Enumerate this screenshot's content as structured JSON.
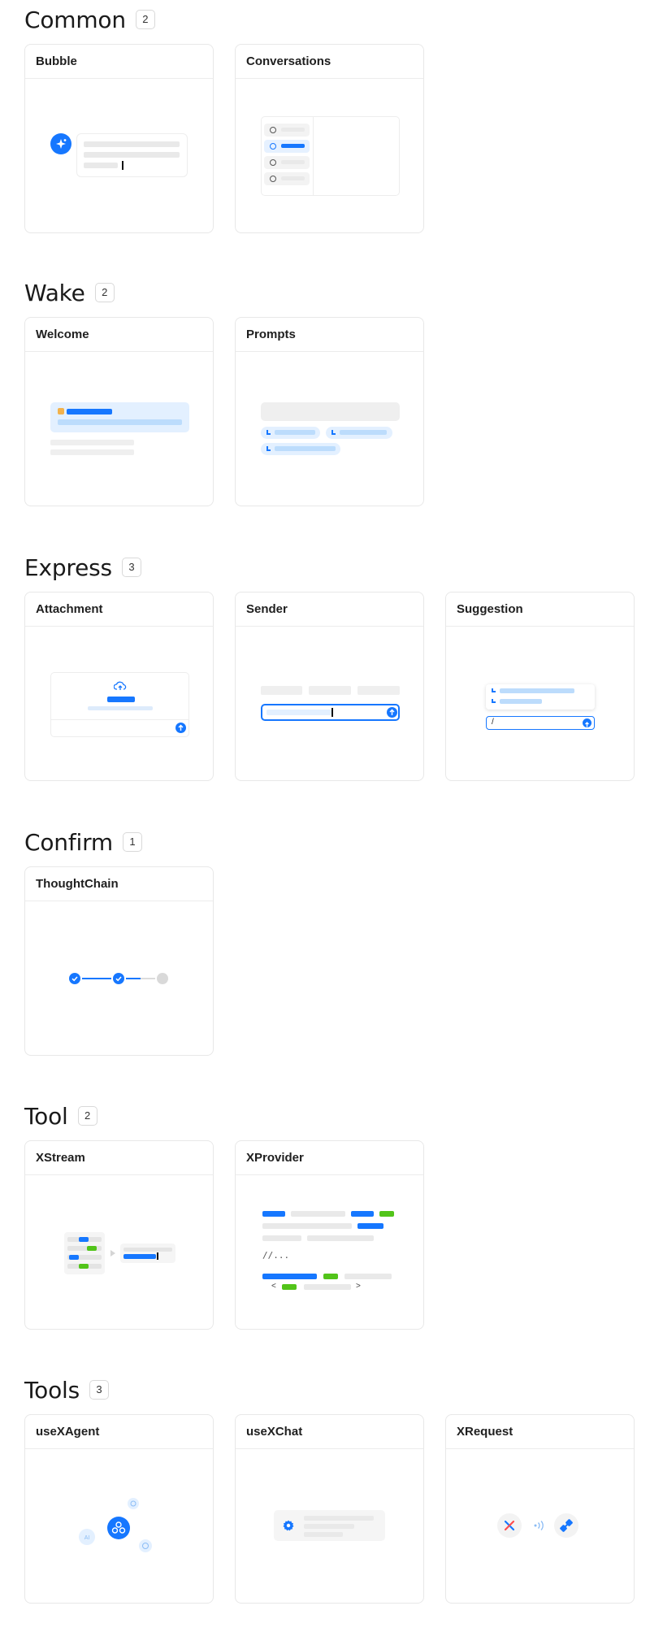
{
  "sections": [
    {
      "title": "Common",
      "count": "2",
      "cards": [
        {
          "title": "Bubble"
        },
        {
          "title": "Conversations"
        }
      ]
    },
    {
      "title": "Wake",
      "count": "2",
      "cards": [
        {
          "title": "Welcome"
        },
        {
          "title": "Prompts"
        }
      ]
    },
    {
      "title": "Express",
      "count": "3",
      "cards": [
        {
          "title": "Attachment"
        },
        {
          "title": "Sender"
        },
        {
          "title": "Suggestion"
        }
      ]
    },
    {
      "title": "Confirm",
      "count": "1",
      "cards": [
        {
          "title": "ThoughtChain"
        }
      ]
    },
    {
      "title": "Tool",
      "count": "2",
      "cards": [
        {
          "title": "XStream"
        },
        {
          "title": "XProvider"
        }
      ]
    },
    {
      "title": "Tools",
      "count": "3",
      "cards": [
        {
          "title": "useXAgent"
        },
        {
          "title": "useXChat"
        },
        {
          "title": "XRequest"
        }
      ]
    }
  ],
  "previews": {
    "suggestion_input": "/",
    "xprovider_comment": "//...",
    "xprovider_lt": "<",
    "xprovider_gt": ">",
    "useXAgent_ai": "AI"
  },
  "colors": {
    "primary": "#1677ff",
    "light_primary": "#bcdcfc",
    "green": "#52c41a",
    "gray": "#e9e9e9"
  }
}
